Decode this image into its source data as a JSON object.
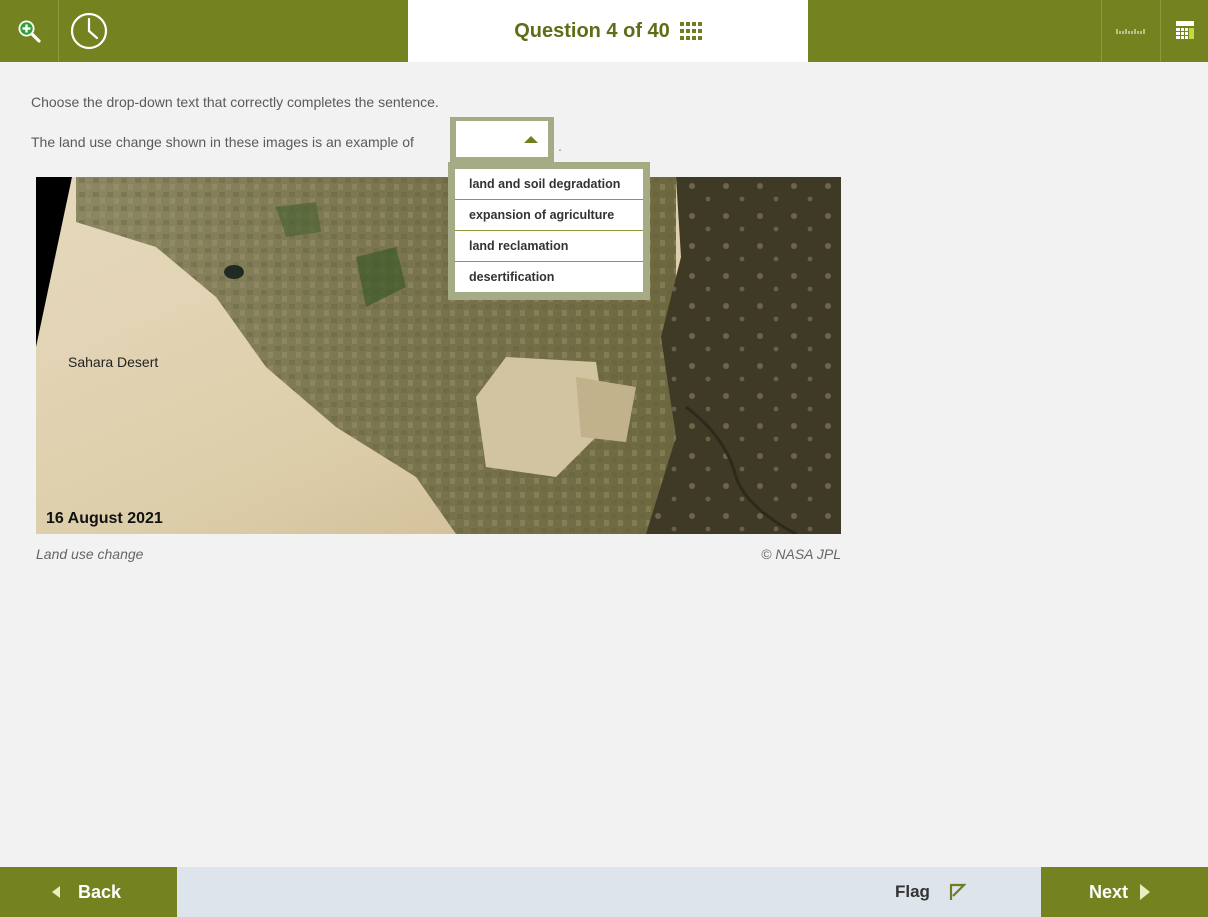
{
  "header": {
    "question_label": "Question 4 of 40",
    "icons": {
      "zoom": "zoom-in-icon",
      "timer": "clock-icon",
      "navigator": "grid-icon",
      "ruler": "ruler-icon",
      "calculator": "calculator-icon"
    }
  },
  "question": {
    "instruction": "Choose the drop-down text that correctly completes the sentence.",
    "sentence_before": "The land use change shown in these images is an example of",
    "sentence_after": ".",
    "selected_value": "",
    "options": [
      "land and soil degradation",
      "expansion of agriculture",
      "land reclamation",
      "desertification"
    ]
  },
  "image": {
    "region_label": "Sahara Desert",
    "date_label": "16 August 2021",
    "caption": "Land use change",
    "credit": "© NASA JPL"
  },
  "footer": {
    "back_label": "Back",
    "flag_label": "Flag",
    "next_label": "Next"
  },
  "colors": {
    "accent": "#748320",
    "accent_dark": "#5f6d16",
    "dropdown_border": "#a4ab85",
    "footer_bg": "#dde4eb",
    "page_bg": "#f2f2f2"
  }
}
